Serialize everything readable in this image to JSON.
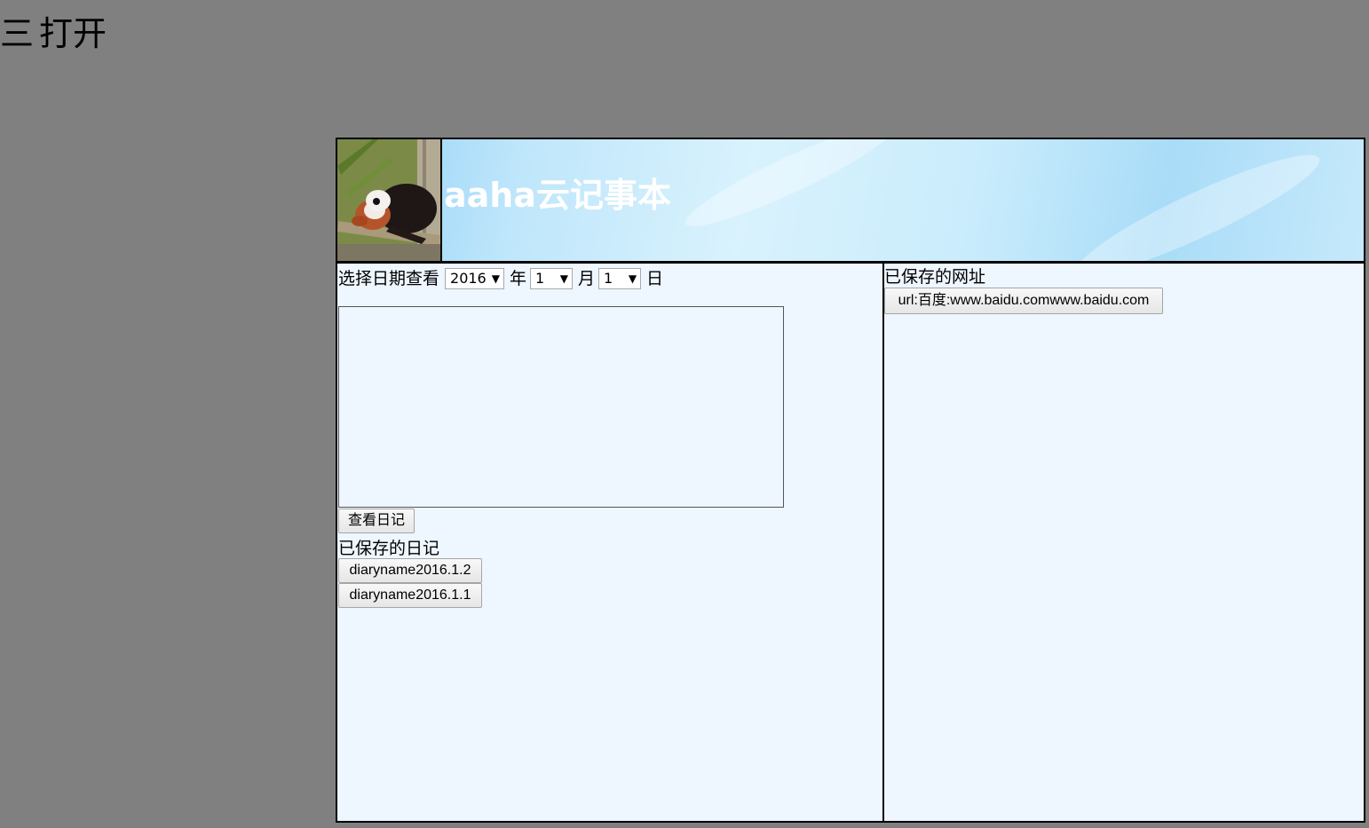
{
  "menu": {
    "icon": "menu-icon",
    "glyph": "三",
    "open_label": "打开"
  },
  "header": {
    "title": "aaha云记事本",
    "avatar": "red-panda-avatar-image"
  },
  "diary_panel": {
    "date_prompt": "选择日期查看",
    "year_value": "2016",
    "year_unit": "年",
    "month_value": "1",
    "month_unit": "月",
    "day_value": "1",
    "day_unit": "日",
    "diary_text": "",
    "view_button": "查看日记",
    "saved_label": "已保存的日记",
    "saved_diaries": [
      "diaryname2016.1.2",
      "diaryname2016.1.1"
    ]
  },
  "url_panel": {
    "saved_label": "已保存的网址",
    "saved_urls": [
      "url:百度:www.baidu.comwww.baidu.com"
    ]
  },
  "colors": {
    "page_background": "#808080",
    "panel_background": "#eef6ff",
    "banner_light": "#d9f2fd",
    "banner_dark": "#8fd0f5",
    "title_text": "#ffffff"
  }
}
